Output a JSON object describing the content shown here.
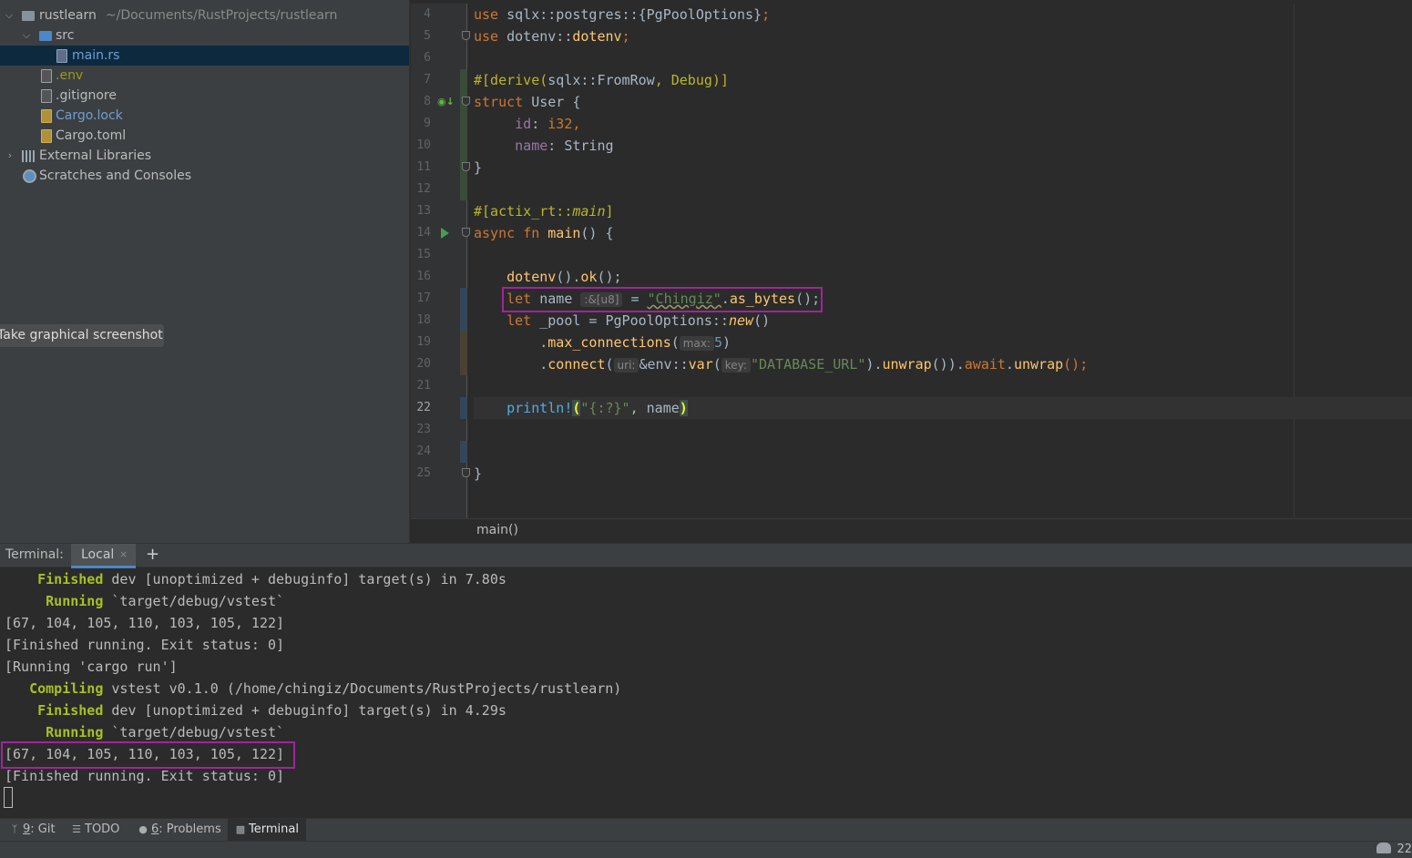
{
  "project_tree": {
    "root": {
      "name": "rustlearn",
      "path": "~/Documents/RustProjects/rustlearn"
    },
    "src_folder": "src",
    "files": [
      "main.rs",
      ".env",
      ".gitignore",
      "Cargo.lock",
      "Cargo.toml"
    ],
    "external_libraries": "External Libraries",
    "scratches": "Scratches and Consoles"
  },
  "tooltip": "Take graphical screenshot",
  "editor": {
    "line_numbers": [
      "4",
      "5",
      "6",
      "7",
      "8",
      "9",
      "10",
      "11",
      "12",
      "13",
      "14",
      "15",
      "16",
      "17",
      "18",
      "19",
      "20",
      "21",
      "22",
      "23",
      "24",
      "25"
    ],
    "current_line": "22",
    "breadcrumb": "main()",
    "code": {
      "l4": {
        "kw": "use",
        "path": " sqlx::postgres::{PgPoolOptions}",
        "semi": ";"
      },
      "l5": {
        "kw": "use",
        "path": " dotenv::",
        "fn": "dotenv",
        "semi": ";"
      },
      "l7": {
        "attr": "#[derive(",
        "a1": "sqlx::FromRow",
        "a2": ", Debug)]"
      },
      "l8": {
        "kw": "struct",
        "rest": " User {"
      },
      "l9": {
        "field": "id",
        "colon": ": ",
        "type": "i32",
        "comma": ","
      },
      "l10": {
        "field": "name",
        "colon": ": ",
        "type": "String"
      },
      "l11": {
        "text": "}"
      },
      "l13": {
        "attr": "#[actix_rt::",
        "attr_fn": "main",
        "close": "]"
      },
      "l14": {
        "kw1": "async",
        "kw2": "fn",
        "fn": "main",
        "rest": "() {"
      },
      "l16": {
        "fn": "dotenv",
        "mid": "().",
        "fn2": "ok",
        "rest": "();"
      },
      "l17": {
        "kw": "let",
        "var": " name ",
        "hint": ":&[u8]",
        "eq": " = ",
        "str": "\"Chingiz\"",
        "dot": ".",
        "fn": "as_bytes",
        "rest": "();"
      },
      "l18": {
        "kw": "let",
        "var": " _pool = PgPoolOptions::",
        "fn": "new",
        "rest": "()"
      },
      "l19": {
        "dot": ".",
        "fn": "max_connections",
        "paren": "(",
        "hint": "max:",
        "num": "5",
        "close": ")"
      },
      "l20": {
        "dot": ".",
        "fn": "connect",
        "paren": "(",
        "hint1": "uri:",
        "mid": "&env::",
        "fn2": "var",
        "paren2": "(",
        "hint2": "key:",
        "str": "\"DATABASE_URL\"",
        "after": ").",
        "fn3": "unwrap",
        "after2": "()).",
        "kw": "await",
        "dot2": ".",
        "fn4": "unwrap",
        "end": "();"
      },
      "l22": {
        "mac": "println!",
        "open": "(",
        "str": "\"{:?}\"",
        "args": ", name",
        "close": ")"
      },
      "l25": {
        "text": "}"
      }
    }
  },
  "terminal": {
    "header_label": "Terminal:",
    "tab": "Local",
    "add_icon": "plus-icon",
    "lines": [
      {
        "status": "    Finished",
        "text": " dev [unoptimized + debuginfo] target(s) in 7.80s"
      },
      {
        "status": "     Running",
        "text": " `target/debug/vstest`"
      },
      {
        "status": "",
        "text": "[67, 104, 105, 110, 103, 105, 122]"
      },
      {
        "status": "",
        "text": "[Finished running. Exit status: 0]"
      },
      {
        "status": "",
        "text": "[Running 'cargo run']"
      },
      {
        "status": "   Compiling",
        "text": " vstest v0.1.0 (/home/chingiz/Documents/RustProjects/rustlearn)"
      },
      {
        "status": "    Finished",
        "text": " dev [unoptimized + debuginfo] target(s) in 4.29s"
      },
      {
        "status": "     Running",
        "text": " `target/debug/vstest`"
      },
      {
        "status": "",
        "text": "[67, 104, 105, 110, 103, 105, 122]"
      },
      {
        "status": "",
        "text": "[Finished running. Exit status: 0]"
      }
    ]
  },
  "tool_windows": [
    {
      "mnemonic": "9",
      "label": ": Git",
      "icon": "git-icon"
    },
    {
      "mnemonic": "",
      "label": "TODO",
      "icon": "list-icon"
    },
    {
      "mnemonic": "6",
      "label": ": Problems",
      "icon": "problems-icon"
    },
    {
      "mnemonic": "",
      "label": "Terminal",
      "icon": "terminal-icon"
    }
  ],
  "status_bar": {
    "right_text": "22"
  },
  "colors": {
    "highlight_box": "#a1249b",
    "selection": "#0d293e",
    "accent": "#4a88c7"
  }
}
